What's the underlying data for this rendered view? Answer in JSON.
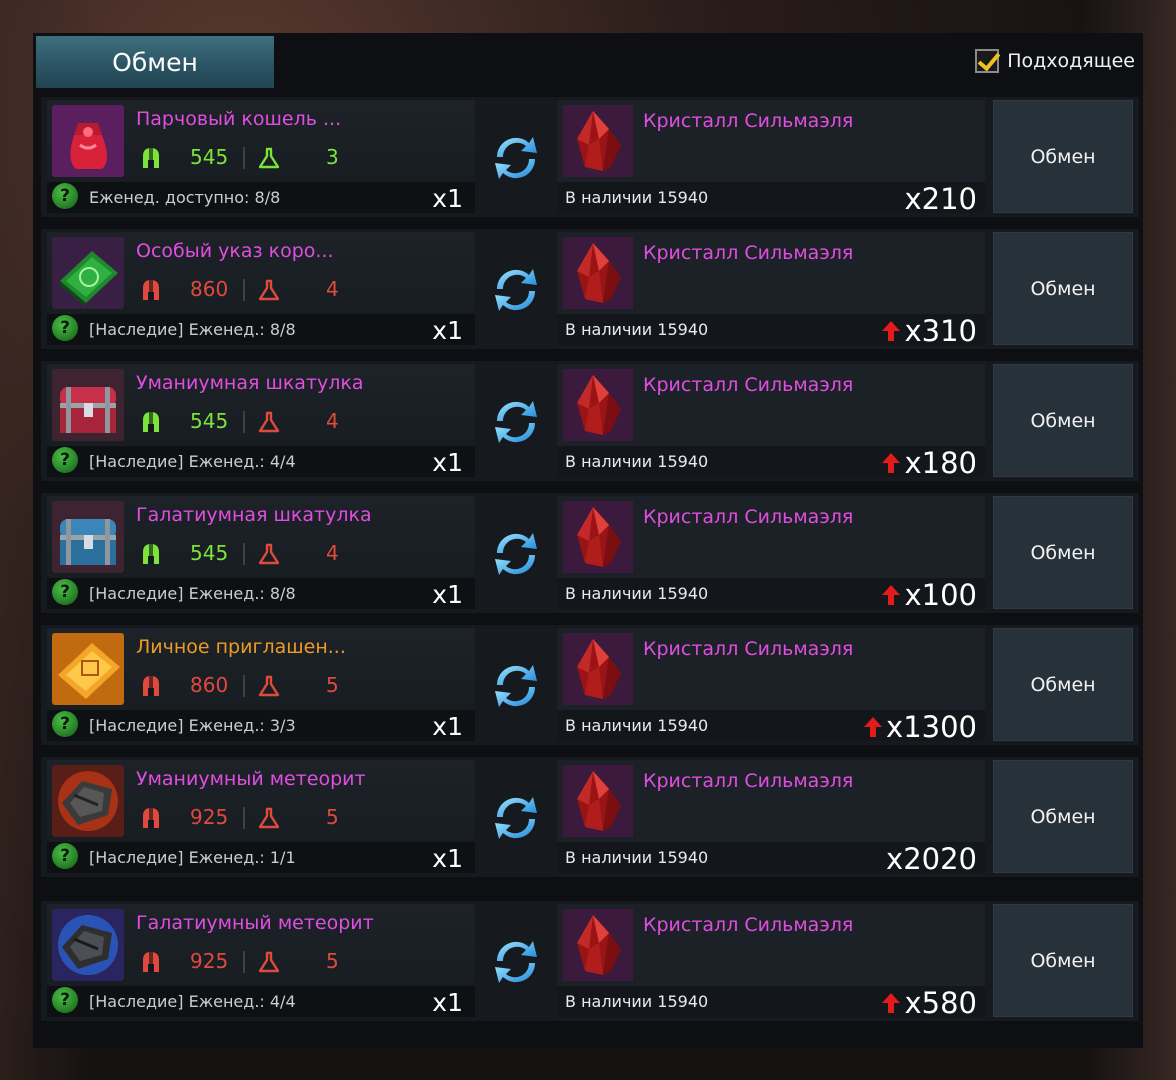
{
  "header": {
    "tab_label": "Обмен",
    "filter_label": "Подходящее",
    "filter_checked": true
  },
  "colors": {
    "magenta": "#e04ee0",
    "orange": "#ef9a24",
    "green": "#7ce33a",
    "red": "#e04a3c",
    "check": "#f0c020"
  },
  "target": {
    "name": "Кристалл Сильмаэля",
    "stock_label": "В наличии 15940",
    "icon": "red-crystal-icon"
  },
  "button_label": "Обмен",
  "help_icon_glyph": "?",
  "rows": [
    {
      "name": "Парчовый кошель ...",
      "name_color": "magenta",
      "icon": "red-pouch-icon",
      "stat1": "545",
      "stat1_color": "green",
      "stat2": "3",
      "stat2_color": "green",
      "limit": "Еженед. доступно: 8/8",
      "give_qty": "x1",
      "get_qty": "x210",
      "boosted": false
    },
    {
      "name": "Особый указ коро...",
      "name_color": "magenta",
      "icon": "green-decree-icon",
      "stat1": "860",
      "stat1_color": "red",
      "stat2": "4",
      "stat2_color": "red",
      "limit": "[Наследие] Еженед.: 8/8",
      "give_qty": "x1",
      "get_qty": "x310",
      "boosted": true
    },
    {
      "name": "Уманиумная шкатулка",
      "name_color": "magenta",
      "icon": "red-chest-icon",
      "stat1": "545",
      "stat1_color": "green",
      "stat2": "4",
      "stat2_color": "red",
      "limit": "[Наследие] Еженед.: 4/4",
      "give_qty": "x1",
      "get_qty": "x180",
      "boosted": true
    },
    {
      "name": "Галатиумная шкатулка",
      "name_color": "magenta",
      "icon": "blue-chest-icon",
      "stat1": "545",
      "stat1_color": "green",
      "stat2": "4",
      "stat2_color": "red",
      "limit": "[Наследие] Еженед.: 8/8",
      "give_qty": "x1",
      "get_qty": "x100",
      "boosted": true
    },
    {
      "name": "Личное приглашен...",
      "name_color": "orange",
      "icon": "gold-invitation-icon",
      "stat1": "860",
      "stat1_color": "red",
      "stat2": "5",
      "stat2_color": "red",
      "limit": "[Наследие] Еженед.: 3/3",
      "give_qty": "x1",
      "get_qty": "x1300",
      "boosted": true
    },
    {
      "name": "Уманиумный метеорит",
      "name_color": "magenta",
      "icon": "fire-meteorite-icon",
      "stat1": "925",
      "stat1_color": "red",
      "stat2": "5",
      "stat2_color": "red",
      "limit": "[Наследие] Еженед.: 1/1",
      "give_qty": "x1",
      "get_qty": "x2020",
      "boosted": false
    },
    {
      "name": "Галатиумный метеорит",
      "name_color": "magenta",
      "icon": "blue-meteorite-icon",
      "stat1": "925",
      "stat1_color": "red",
      "stat2": "5",
      "stat2_color": "red",
      "limit": "[Наследие] Еженед.: 4/4",
      "give_qty": "x1",
      "get_qty": "x580",
      "boosted": true
    }
  ]
}
